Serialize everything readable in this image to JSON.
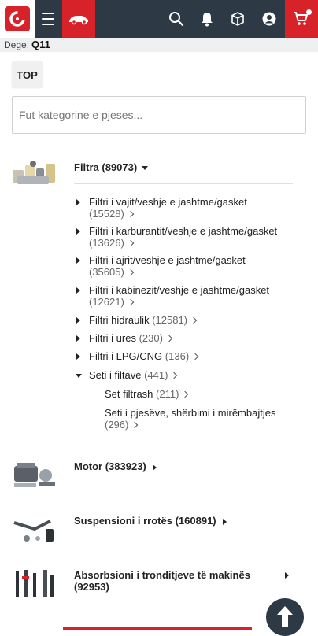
{
  "header": {
    "logo_icon": "autopjese-logo-icon",
    "menu_icon": "hamburger-icon",
    "car_icon": "car-icon",
    "search_icon": "search-icon",
    "bell_icon": "bell-icon",
    "box_icon": "package-icon",
    "user_icon": "user-icon",
    "cart_icon": "cart-icon",
    "accent_color": "#d7222a",
    "bar_color": "#2d3a46"
  },
  "vehicle": {
    "label": "Dege:",
    "value": "Q11"
  },
  "top_button": "TOP",
  "search": {
    "placeholder": "Fut kategorine e pjeses..."
  },
  "categories": [
    {
      "name": "Filtra (89073)",
      "expanded": true,
      "subcategories": [
        {
          "name": "Filtri i vajit/veshje e jashtme/gasket",
          "count": "(15528)"
        },
        {
          "name": "Filtri i karburantit/veshje e jashtme/gasket",
          "count": "(13626)"
        },
        {
          "name": "Filtri i ajrit/veshje e jashtme/gasket",
          "count": "(35605)"
        },
        {
          "name": "Filtri i kabinezit/veshje e jashtme/gasket",
          "count": "(12621)"
        },
        {
          "name": "Filtri hidraulik",
          "count": "(12581)"
        },
        {
          "name": "Filtri i ures",
          "count": "(230)"
        },
        {
          "name": "Filtri i LPG/CNG",
          "count": "(136)"
        },
        {
          "name": "Seti i filtave",
          "count": "(441)",
          "children": [
            {
              "name": "Set filtrash",
              "count": "(211)"
            },
            {
              "name": "Seti i pjesëve, shërbimi i mirëmbajtjes",
              "count": "(296)"
            }
          ]
        }
      ]
    },
    {
      "name": "Motor (383923)"
    },
    {
      "name": "Suspensioni i rrotës (160891)"
    },
    {
      "name": "Absorbsioni i tronditjeve të makinës (92953)"
    }
  ],
  "scroll_top_icon": "arrow-up-icon"
}
